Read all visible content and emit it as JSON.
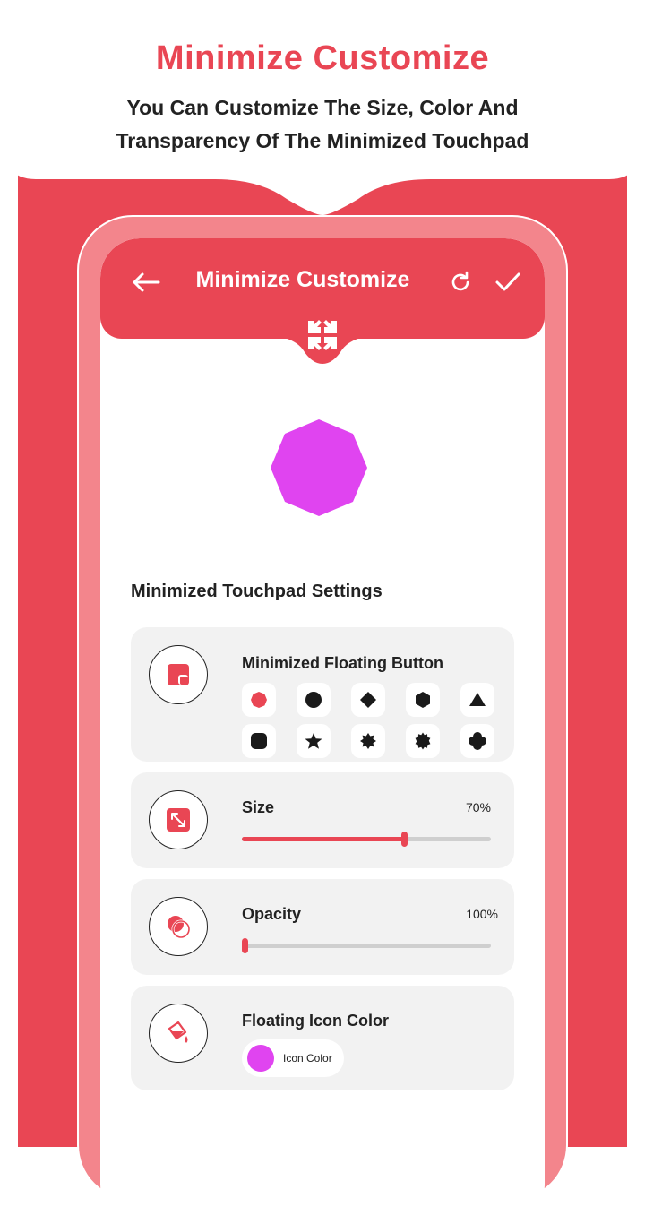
{
  "promo": {
    "title": "Minimize Customize",
    "subtitle_line1": "You Can Customize The Size, Color And",
    "subtitle_line2": "Transparency Of The Minimized Touchpad"
  },
  "header": {
    "title": "Minimize Customize",
    "back_icon": "arrow-left-icon",
    "reset_icon": "refresh-icon",
    "confirm_icon": "check-icon",
    "collapse_icon": "minimize-arrows-icon"
  },
  "preview": {
    "shape": "octagon",
    "color": "#e044f0"
  },
  "settings": {
    "section_title": "Minimized Touchpad Settings",
    "floating_button": {
      "label": "Minimized Floating Button",
      "icon": "floating-window-icon",
      "shapes": [
        "octagon",
        "circle",
        "diamond",
        "hexagon",
        "triangle",
        "rounded-square",
        "star",
        "badge-8",
        "badge-12",
        "clover"
      ],
      "selected_shape": "octagon"
    },
    "size": {
      "label": "Size",
      "value_text": "70%",
      "value": 0.65,
      "icon": "expand-arrows-icon"
    },
    "opacity": {
      "label": "Opacity",
      "value_text": "100%",
      "value": 0.01,
      "icon": "overlap-circles-icon"
    },
    "icon_color": {
      "label": "Floating Icon Color",
      "chip_label": "Icon Color",
      "color": "#e044f0",
      "icon": "paint-bucket-icon"
    }
  },
  "colors": {
    "accent": "#e94654",
    "preview": "#e044f0",
    "card_bg": "#f2f2f2"
  }
}
